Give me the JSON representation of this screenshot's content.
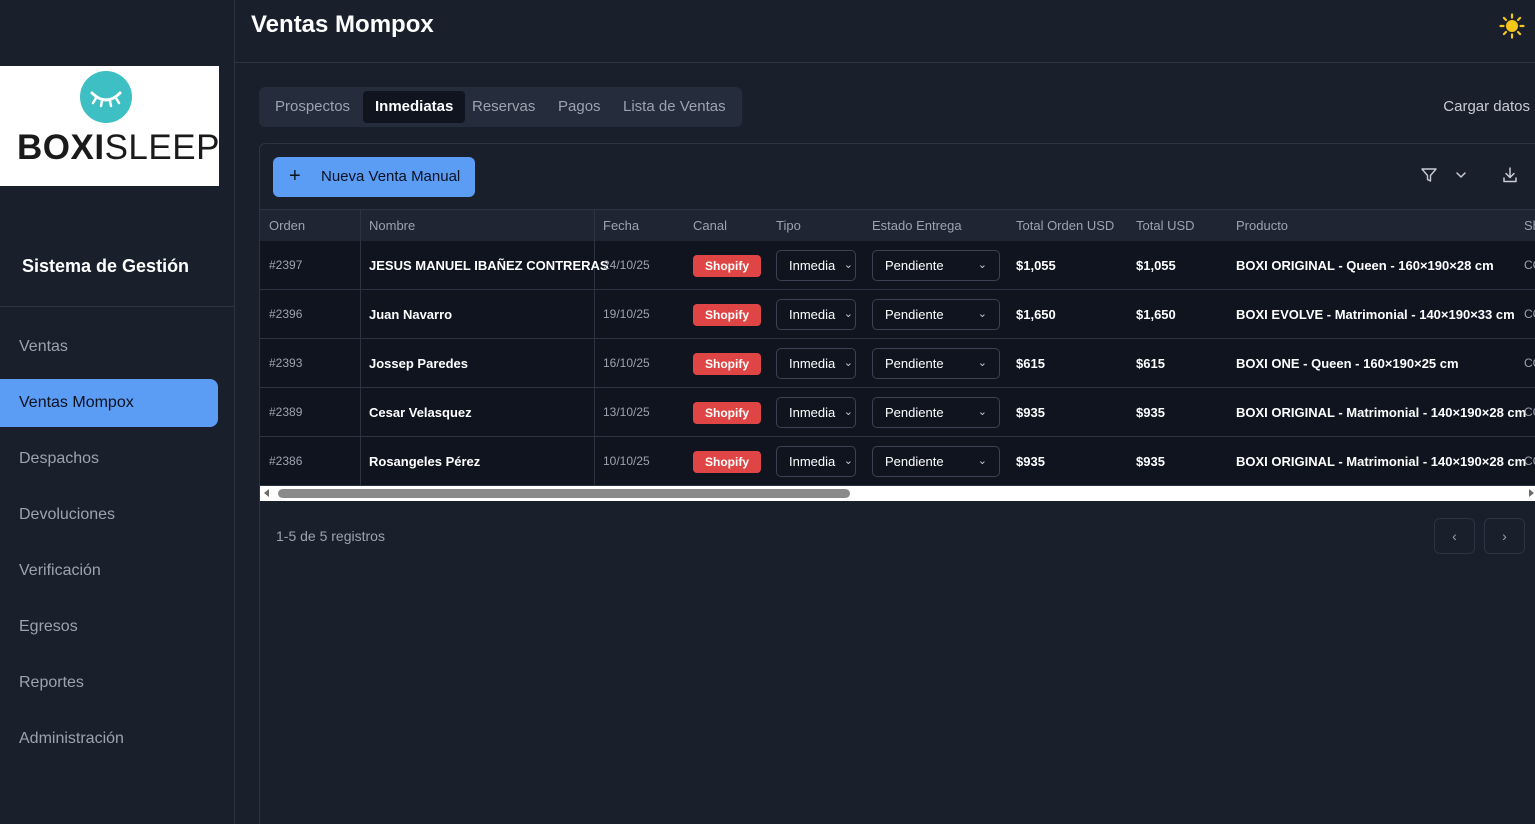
{
  "sidebar": {
    "logo_bold": "BOXI",
    "logo_light": "SLEEP",
    "system_title": "Sistema de Gestión",
    "items": [
      {
        "label": "Ventas"
      },
      {
        "label": "Ventas Mompox"
      },
      {
        "label": "Despachos"
      },
      {
        "label": "Devoluciones"
      },
      {
        "label": "Verificación"
      },
      {
        "label": "Egresos"
      },
      {
        "label": "Reportes"
      },
      {
        "label": "Administración"
      }
    ],
    "active_index": 1
  },
  "header": {
    "title": "Ventas Mompox",
    "theme_icon": "sun-icon"
  },
  "tabs": [
    {
      "label": "Prospectos"
    },
    {
      "label": "Inmediatas"
    },
    {
      "label": "Reservas"
    },
    {
      "label": "Pagos"
    },
    {
      "label": "Lista de Ventas"
    }
  ],
  "active_tab": 1,
  "load_data_label": "Cargar datos",
  "new_sale_label": "Nueva Venta Manual",
  "table": {
    "columns": [
      "Orden",
      "Nombre",
      "Fecha",
      "Canal",
      "Tipo",
      "Estado Entrega",
      "Total Orden USD",
      "Total USD",
      "Producto",
      "Sh"
    ],
    "rows": [
      {
        "orden": "#2397",
        "nombre": "JESUS MANUEL IBAÑEZ CONTRERAS",
        "fecha": "24/10/25",
        "canal": "Shopify",
        "tipo": "Inmedia",
        "estado": "Pendiente",
        "total_orden": "$1,055",
        "total": "$1,055",
        "producto": "BOXI ORIGINAL - Queen - 160×190×28 cm",
        "extra": "CC"
      },
      {
        "orden": "#2396",
        "nombre": "Juan Navarro",
        "fecha": "19/10/25",
        "canal": "Shopify",
        "tipo": "Inmedia",
        "estado": "Pendiente",
        "total_orden": "$1,650",
        "total": "$1,650",
        "producto": "BOXI EVOLVE - Matrimonial - 140×190×33 cm",
        "extra": "CC"
      },
      {
        "orden": "#2393",
        "nombre": "Jossep Paredes",
        "fecha": "16/10/25",
        "canal": "Shopify",
        "tipo": "Inmedia",
        "estado": "Pendiente",
        "total_orden": "$615",
        "total": "$615",
        "producto": "BOXI ONE - Queen - 160×190×25 cm",
        "extra": "CC"
      },
      {
        "orden": "#2389",
        "nombre": "Cesar Velasquez",
        "fecha": "13/10/25",
        "canal": "Shopify",
        "tipo": "Inmedia",
        "estado": "Pendiente",
        "total_orden": "$935",
        "total": "$935",
        "producto": "BOXI ORIGINAL - Matrimonial - 140×190×28 cm",
        "extra": "CC"
      },
      {
        "orden": "#2386",
        "nombre": "Rosangeles Pérez",
        "fecha": "10/10/25",
        "canal": "Shopify",
        "tipo": "Inmedia",
        "estado": "Pendiente",
        "total_orden": "$935",
        "total": "$935",
        "producto": "BOXI ORIGINAL - Matrimonial - 140×190×28 cm",
        "extra": "CC"
      }
    ]
  },
  "pagination": {
    "records_text": "1-5 de 5 registros",
    "prev": "‹",
    "next": "›"
  },
  "colors": {
    "accent": "#5b9cf5",
    "badge": "#e04545",
    "background": "#1a1f2c",
    "row": "#0f141f"
  }
}
